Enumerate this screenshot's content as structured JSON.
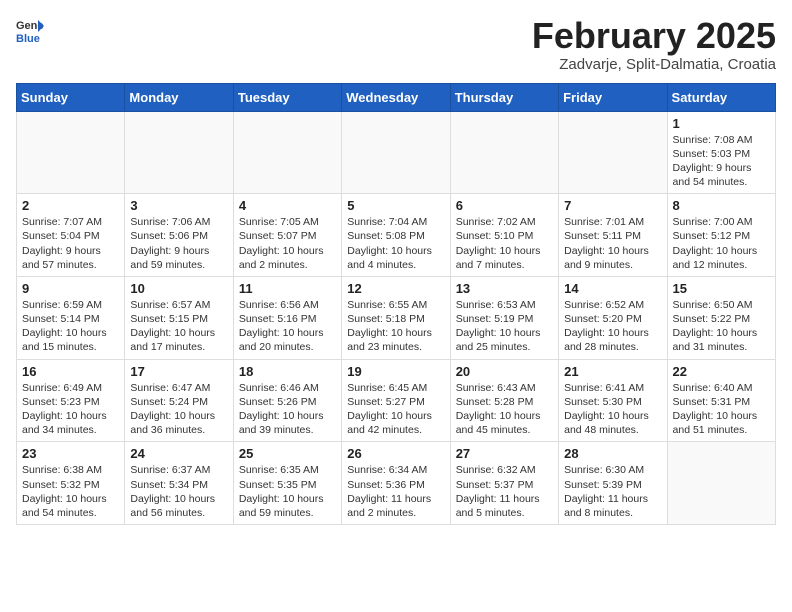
{
  "logo": {
    "general": "General",
    "blue": "Blue"
  },
  "title": "February 2025",
  "subtitle": "Zadvarje, Split-Dalmatia, Croatia",
  "weekdays": [
    "Sunday",
    "Monday",
    "Tuesday",
    "Wednesday",
    "Thursday",
    "Friday",
    "Saturday"
  ],
  "weeks": [
    [
      {
        "day": "",
        "text": ""
      },
      {
        "day": "",
        "text": ""
      },
      {
        "day": "",
        "text": ""
      },
      {
        "day": "",
        "text": ""
      },
      {
        "day": "",
        "text": ""
      },
      {
        "day": "",
        "text": ""
      },
      {
        "day": "1",
        "text": "Sunrise: 7:08 AM\nSunset: 5:03 PM\nDaylight: 9 hours and 54 minutes."
      }
    ],
    [
      {
        "day": "2",
        "text": "Sunrise: 7:07 AM\nSunset: 5:04 PM\nDaylight: 9 hours and 57 minutes."
      },
      {
        "day": "3",
        "text": "Sunrise: 7:06 AM\nSunset: 5:06 PM\nDaylight: 9 hours and 59 minutes."
      },
      {
        "day": "4",
        "text": "Sunrise: 7:05 AM\nSunset: 5:07 PM\nDaylight: 10 hours and 2 minutes."
      },
      {
        "day": "5",
        "text": "Sunrise: 7:04 AM\nSunset: 5:08 PM\nDaylight: 10 hours and 4 minutes."
      },
      {
        "day": "6",
        "text": "Sunrise: 7:02 AM\nSunset: 5:10 PM\nDaylight: 10 hours and 7 minutes."
      },
      {
        "day": "7",
        "text": "Sunrise: 7:01 AM\nSunset: 5:11 PM\nDaylight: 10 hours and 9 minutes."
      },
      {
        "day": "8",
        "text": "Sunrise: 7:00 AM\nSunset: 5:12 PM\nDaylight: 10 hours and 12 minutes."
      }
    ],
    [
      {
        "day": "9",
        "text": "Sunrise: 6:59 AM\nSunset: 5:14 PM\nDaylight: 10 hours and 15 minutes."
      },
      {
        "day": "10",
        "text": "Sunrise: 6:57 AM\nSunset: 5:15 PM\nDaylight: 10 hours and 17 minutes."
      },
      {
        "day": "11",
        "text": "Sunrise: 6:56 AM\nSunset: 5:16 PM\nDaylight: 10 hours and 20 minutes."
      },
      {
        "day": "12",
        "text": "Sunrise: 6:55 AM\nSunset: 5:18 PM\nDaylight: 10 hours and 23 minutes."
      },
      {
        "day": "13",
        "text": "Sunrise: 6:53 AM\nSunset: 5:19 PM\nDaylight: 10 hours and 25 minutes."
      },
      {
        "day": "14",
        "text": "Sunrise: 6:52 AM\nSunset: 5:20 PM\nDaylight: 10 hours and 28 minutes."
      },
      {
        "day": "15",
        "text": "Sunrise: 6:50 AM\nSunset: 5:22 PM\nDaylight: 10 hours and 31 minutes."
      }
    ],
    [
      {
        "day": "16",
        "text": "Sunrise: 6:49 AM\nSunset: 5:23 PM\nDaylight: 10 hours and 34 minutes."
      },
      {
        "day": "17",
        "text": "Sunrise: 6:47 AM\nSunset: 5:24 PM\nDaylight: 10 hours and 36 minutes."
      },
      {
        "day": "18",
        "text": "Sunrise: 6:46 AM\nSunset: 5:26 PM\nDaylight: 10 hours and 39 minutes."
      },
      {
        "day": "19",
        "text": "Sunrise: 6:45 AM\nSunset: 5:27 PM\nDaylight: 10 hours and 42 minutes."
      },
      {
        "day": "20",
        "text": "Sunrise: 6:43 AM\nSunset: 5:28 PM\nDaylight: 10 hours and 45 minutes."
      },
      {
        "day": "21",
        "text": "Sunrise: 6:41 AM\nSunset: 5:30 PM\nDaylight: 10 hours and 48 minutes."
      },
      {
        "day": "22",
        "text": "Sunrise: 6:40 AM\nSunset: 5:31 PM\nDaylight: 10 hours and 51 minutes."
      }
    ],
    [
      {
        "day": "23",
        "text": "Sunrise: 6:38 AM\nSunset: 5:32 PM\nDaylight: 10 hours and 54 minutes."
      },
      {
        "day": "24",
        "text": "Sunrise: 6:37 AM\nSunset: 5:34 PM\nDaylight: 10 hours and 56 minutes."
      },
      {
        "day": "25",
        "text": "Sunrise: 6:35 AM\nSunset: 5:35 PM\nDaylight: 10 hours and 59 minutes."
      },
      {
        "day": "26",
        "text": "Sunrise: 6:34 AM\nSunset: 5:36 PM\nDaylight: 11 hours and 2 minutes."
      },
      {
        "day": "27",
        "text": "Sunrise: 6:32 AM\nSunset: 5:37 PM\nDaylight: 11 hours and 5 minutes."
      },
      {
        "day": "28",
        "text": "Sunrise: 6:30 AM\nSunset: 5:39 PM\nDaylight: 11 hours and 8 minutes."
      },
      {
        "day": "",
        "text": ""
      }
    ]
  ]
}
